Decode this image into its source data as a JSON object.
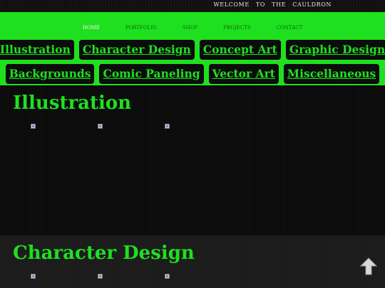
{
  "header": {
    "welcome_text": "WELCOME TO THE CAULDRON"
  },
  "nav": {
    "links": [
      {
        "label": "HOME",
        "active": true
      },
      {
        "label": "PORTFOLIO",
        "active": false
      },
      {
        "label": "SHOP",
        "active": false
      },
      {
        "label": "PROJECTS",
        "active": false
      },
      {
        "label": "CONTACT",
        "active": false
      }
    ]
  },
  "categories": {
    "row1": [
      "Illustration",
      "Character Design",
      "Concept Art",
      "Graphic Design"
    ],
    "row2": [
      "Backgrounds",
      "Comic Paneling",
      "Vector Art",
      "Miscellaneous"
    ]
  },
  "sections": [
    {
      "title": "Illustration",
      "image_count": 3
    },
    {
      "title": "Character Design",
      "image_count": 3
    }
  ],
  "colors": {
    "accent_green": "#1fe01f",
    "background": "#0b0b0b",
    "button_bg": "#0c0c0c"
  },
  "icons": {
    "scroll_top": "up-arrow-icon"
  }
}
